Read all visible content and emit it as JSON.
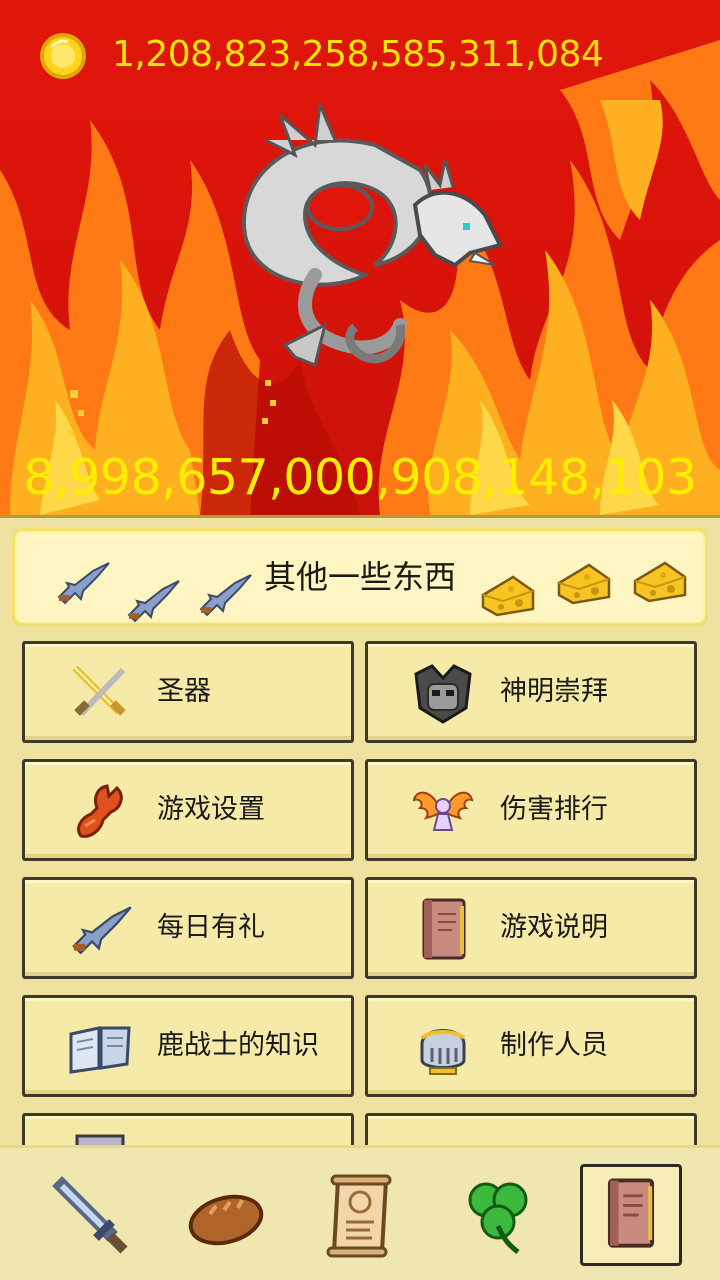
{
  "status": {
    "gold": "1,208,823,258,585,311,084",
    "boss_hp": "8,998,657,000,908,148,103"
  },
  "boss": {
    "icon": "silver-dragon-icon"
  },
  "panel": {
    "title": "其他一些东西",
    "header_icons": [
      "swordfish-icon",
      "swordfish-icon",
      "swordfish-icon",
      "cheese-icon",
      "cheese-icon",
      "cheese-icon"
    ]
  },
  "menu": {
    "items": [
      {
        "label": "圣器",
        "icon": "crossed-swords-icon"
      },
      {
        "label": "神明崇拜",
        "icon": "armored-god-icon"
      },
      {
        "label": "游戏设置",
        "icon": "lobster-claw-icon"
      },
      {
        "label": "伤害排行",
        "icon": "winged-angel-icon"
      },
      {
        "label": "每日有礼",
        "icon": "swordfish-icon"
      },
      {
        "label": "游戏说明",
        "icon": "book-icon"
      },
      {
        "label": "鹿战士的知识",
        "icon": "open-book-icon"
      },
      {
        "label": "制作人员",
        "icon": "knight-helmet-icon"
      }
    ]
  },
  "bottom_nav": {
    "items": [
      {
        "icon": "sword-icon",
        "active": false
      },
      {
        "icon": "bread-icon",
        "active": false
      },
      {
        "icon": "scroll-icon",
        "active": false
      },
      {
        "icon": "clover-icon",
        "active": false
      },
      {
        "icon": "book-icon",
        "active": true
      }
    ]
  },
  "colors": {
    "scene_red": "#d8130a",
    "number_yellow": "#ffee00",
    "panel_bg": "#efe2a0",
    "button_bg": "#f6eaa8"
  }
}
